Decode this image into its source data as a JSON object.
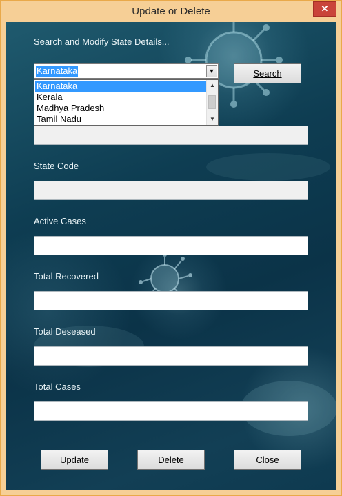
{
  "window": {
    "title": "Update or Delete",
    "close_glyph": "✕"
  },
  "search": {
    "heading": "Search and Modify State Details...",
    "selected_state": "Karnataka",
    "options": [
      "Karnataka",
      "Kerala",
      "Madhya Pradesh",
      "Tamil Nadu"
    ],
    "search_label": "Search"
  },
  "fields": {
    "state_code_label": "State Code",
    "active_cases_label": "Active Cases",
    "total_recovered_label": "Total Recovered",
    "total_deseased_label": "Total Deseased",
    "total_cases_label": "Total Cases"
  },
  "buttons": {
    "update": "Update",
    "delete": "Delete",
    "close": "Close"
  },
  "icons": {
    "combo_arrow": "chevron-down-icon",
    "scroll_up": "chevron-up-icon",
    "scroll_down": "chevron-down-icon",
    "close": "close-icon"
  },
  "colors": {
    "title_bar": "#f6cf96",
    "close_button": "#c9443a",
    "selection": "#3399ff",
    "background": "#0e3d52"
  }
}
